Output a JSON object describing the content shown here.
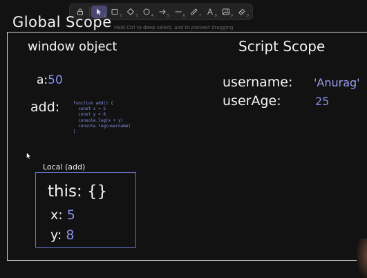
{
  "toolbar": {
    "tools": [
      {
        "icon": "lock-icon",
        "num": ""
      },
      {
        "icon": "cursor-icon",
        "num": "1",
        "active": true
      },
      {
        "icon": "rectangle-icon",
        "num": "2"
      },
      {
        "icon": "diamond-icon",
        "num": "3"
      },
      {
        "icon": "ellipse-icon",
        "num": "4"
      },
      {
        "icon": "arrow-icon",
        "num": "5"
      },
      {
        "icon": "line-icon",
        "num": "6"
      },
      {
        "icon": "pencil-icon",
        "num": "7"
      },
      {
        "icon": "text-icon",
        "num": "8"
      },
      {
        "icon": "image-icon",
        "num": "9"
      },
      {
        "icon": "eraser-icon",
        "num": "0"
      }
    ],
    "hint": "Hold Ctrl to deep select, and to prevent dragging"
  },
  "canvas": {
    "title": "Global Scope",
    "window_object_label": "window object",
    "script_scope_label": "Script Scope",
    "a_key": "a:",
    "a_value": "50",
    "add_key": "add:",
    "add_code": [
      "function add() {",
      "  const x = 5",
      "  const y = 8",
      "  console.log(x + y)",
      "  console.log(username)",
      "}"
    ],
    "username_key": "username:",
    "username_value": "'Anurag'",
    "userage_key": "userAge:",
    "userage_value": "25",
    "local_label": "Local (add)",
    "this_key": "this:",
    "this_value": "{}",
    "x_key": "x:",
    "x_value": "5",
    "y_key": "y:",
    "y_value": "8"
  },
  "colors": {
    "background": "#121212",
    "value_blue": "#8a90e8",
    "active_tool": "#4a4870"
  }
}
